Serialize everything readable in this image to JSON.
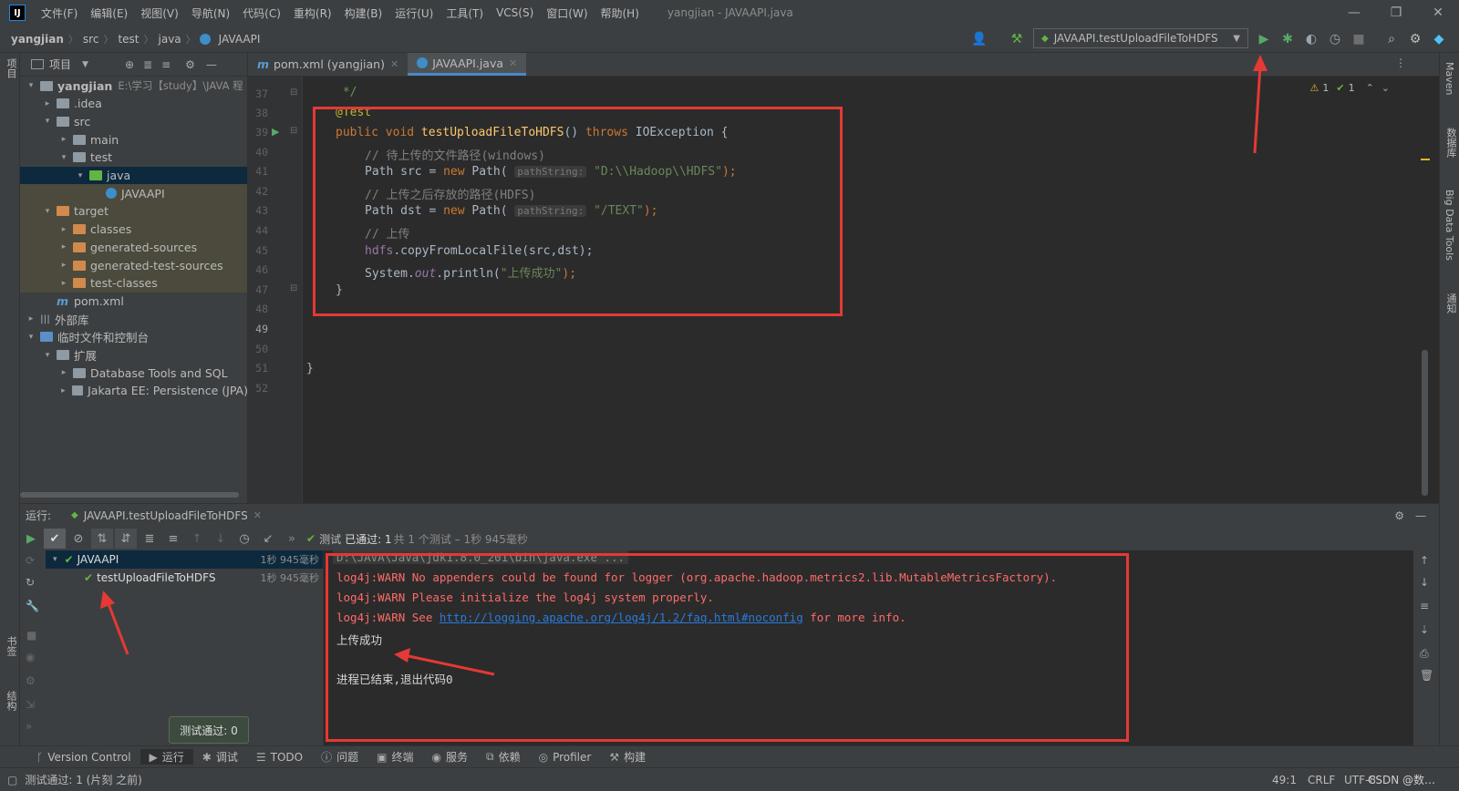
{
  "menubar": {
    "items": [
      "文件(F)",
      "编辑(E)",
      "视图(V)",
      "导航(N)",
      "代码(C)",
      "重构(R)",
      "构建(B)",
      "运行(U)",
      "工具(T)",
      "VCS(S)",
      "窗口(W)",
      "帮助(H)"
    ],
    "window_title": "yangjian - JAVAAPI.java"
  },
  "navbar": {
    "breadcrumbs": [
      "yangjian",
      "src",
      "test",
      "java",
      "JAVAAPI"
    ],
    "run_config": "JAVAAPI.testUploadFileToHDFS"
  },
  "project": {
    "header": "项目",
    "tree": [
      {
        "label": "yangjian",
        "extra": "E:\\学习【study】\\JAVA 程",
        "indent": 0,
        "arrow": "▾",
        "icon": "folder",
        "bold": true
      },
      {
        "label": ".idea",
        "indent": 1,
        "arrow": "▸",
        "icon": "folder"
      },
      {
        "label": "src",
        "indent": 1,
        "arrow": "▾",
        "icon": "folder"
      },
      {
        "label": "main",
        "indent": 2,
        "arrow": "▸",
        "icon": "folder"
      },
      {
        "label": "test",
        "indent": 2,
        "arrow": "▾",
        "icon": "folder"
      },
      {
        "label": "java",
        "indent": 3,
        "arrow": "▾",
        "icon": "folder-green",
        "selected": true
      },
      {
        "label": "JAVAAPI",
        "indent": 4,
        "arrow": "",
        "icon": "class",
        "highlight": true
      },
      {
        "label": "target",
        "indent": 1,
        "arrow": "▾",
        "icon": "folder-orange",
        "highlight": true
      },
      {
        "label": "classes",
        "indent": 2,
        "arrow": "▸",
        "icon": "folder-orange",
        "highlight": true
      },
      {
        "label": "generated-sources",
        "indent": 2,
        "arrow": "▸",
        "icon": "folder-orange",
        "highlight": true
      },
      {
        "label": "generated-test-sources",
        "indent": 2,
        "arrow": "▸",
        "icon": "folder-orange",
        "highlight": true
      },
      {
        "label": "test-classes",
        "indent": 2,
        "arrow": "▸",
        "icon": "folder-orange",
        "highlight": true
      },
      {
        "label": "pom.xml",
        "indent": 1,
        "arrow": "",
        "icon": "maven"
      },
      {
        "label": "外部库",
        "indent": 0,
        "arrow": "▸",
        "icon": "library"
      },
      {
        "label": "临时文件和控制台",
        "indent": 0,
        "arrow": "▾",
        "icon": "scratch"
      },
      {
        "label": "扩展",
        "indent": 1,
        "arrow": "▾",
        "icon": "folder"
      },
      {
        "label": "Database Tools and SQL",
        "indent": 2,
        "arrow": "▸",
        "icon": "folder"
      },
      {
        "label": "Jakarta EE: Persistence (JPA)",
        "indent": 2,
        "arrow": "▸",
        "icon": "folder"
      }
    ]
  },
  "editor": {
    "tabs": [
      {
        "label": "pom.xml (yangjian)",
        "active": false
      },
      {
        "label": "JAVAAPI.java",
        "active": true
      }
    ],
    "warnings": "1",
    "checks": "1",
    "line_numbers": [
      "37",
      "38",
      "39",
      "40",
      "41",
      "42",
      "43",
      "44",
      "45",
      "46",
      "47",
      "48",
      "49",
      "50",
      "51",
      "52"
    ],
    "code": {
      "l37": "*/",
      "l38": "@Test",
      "l39_kw": "public void",
      "l39_fn": "testUploadFileToHDFS",
      "l39_rest": "()",
      "l39_throws": "throws",
      "l39_exc": "IOException {",
      "l40": "// 待上传的文件路径(windows)",
      "l41_a": "Path src = ",
      "l41_new": "new",
      "l41_b": " Path(",
      "l41_hint": "pathString:",
      "l41_str": "\"D:\\\\Hadoop\\\\HDFS\"",
      "l41_end": ");",
      "l42": "// 上传之后存放的路径(HDFS)",
      "l43_a": "Path dst = ",
      "l43_new": "new",
      "l43_b": " Path(",
      "l43_hint": "pathString:",
      "l43_str": "\"/TEXT\"",
      "l43_end": ");",
      "l44": "// 上传",
      "l45_fld": "hdfs",
      "l45_rest": ".copyFromLocalFile(src,dst);",
      "l46_a": "System.",
      "l46_out": "out",
      "l46_b": ".println(",
      "l46_str": "\"上传成功\"",
      "l46_end": ");",
      "l47": "}",
      "l51": "}"
    }
  },
  "run": {
    "label": "运行:",
    "tab": "JAVAAPI.testUploadFileToHDFS",
    "status_prefix": "测试",
    "status_passed": "已通过: 1",
    "status_rest": "共 1 个测试 – 1秒 945毫秒",
    "tests": [
      {
        "name": "JAVAAPI",
        "time": "1秒 945毫秒"
      },
      {
        "name": "testUploadFileToHDFS",
        "time": "1秒 945毫秒"
      }
    ],
    "console": {
      "cmd": "D:\\JAVA\\Java\\jdk1.8.0_201\\bin\\java.exe ...",
      "warn1": "log4j:WARN No appenders could be found for logger (org.apache.hadoop.metrics2.lib.MutableMetricsFactory).",
      "warn2": "log4j:WARN Please initialize the log4j system properly.",
      "warn3_a": "log4j:WARN See ",
      "warn3_link": "http://logging.apache.org/log4j/1.2/faq.html#noconfig",
      "warn3_b": " for more info.",
      "success": "上传成功",
      "exit": "进程已结束,退出代码0"
    },
    "tooltip": "测试通过: 0"
  },
  "tool_tabs": [
    "Version Control",
    "运行",
    "调试",
    "TODO",
    "问题",
    "终端",
    "服务",
    "依赖",
    "Profiler",
    "构建"
  ],
  "statusbar": {
    "message": "测试通过: 1 (片刻 之前)",
    "position": "49:1",
    "line_sep": "CRLF",
    "encoding": "UTF-8",
    "watermark": "CSDN @数…"
  },
  "side_labels": {
    "left_top": "项目",
    "left_bookmarks": "书签",
    "left_structure": "结构",
    "right_maven": "Maven",
    "right_db": "数据库",
    "right_bigdata": "Big Data Tools",
    "right_notify": "通知"
  },
  "colors": {
    "accent": "#4a88c7",
    "annotation_red": "#e53935",
    "pass_green": "#62b543"
  }
}
